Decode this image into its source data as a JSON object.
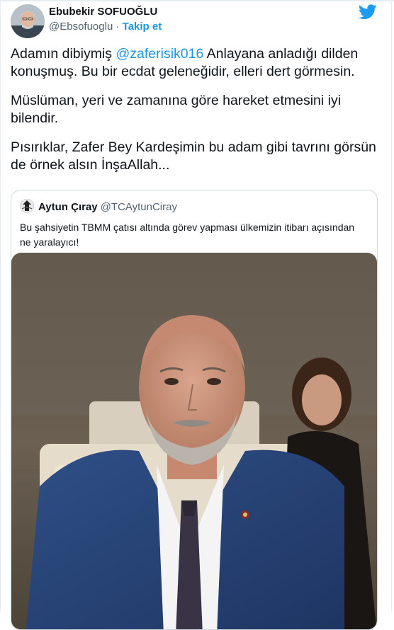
{
  "tweet": {
    "author": {
      "display_name": "Ebubekir SOFUOĞLU",
      "handle": "@Ebsofuoglu",
      "separator": " · ",
      "follow_label": "Takip et"
    },
    "paragraphs": [
      {
        "before": "Adamın dibiymiş ",
        "mention": "@zaferisik016",
        "after": " Anlayana anladığı dilden konuşmuş. Bu bir ecdat geleneğidir, elleri dert görmesin."
      },
      {
        "text": "Müslüman, yeri ve zamanına göre hareket etmesini iyi bilendir."
      },
      {
        "text": "Pısırıklar, Zafer Bey Kardeşimin bu adam gibi tavrını görsün de örnek alsın İnşaAllah..."
      }
    ]
  },
  "quoted_tweet": {
    "display_name": "Aytun Çıray",
    "handle": "@TCAytunCiray",
    "text": "Bu şahsiyetin TBMM çatısı altında görev yapması ülkemizin itibarı açısından ne yaralayıcı!"
  },
  "colors": {
    "accent": "#1b95e0",
    "text": "#0f1419",
    "secondary": "#536471",
    "border": "#cfd9de"
  },
  "icons": {
    "brand": "twitter-bird-icon"
  }
}
